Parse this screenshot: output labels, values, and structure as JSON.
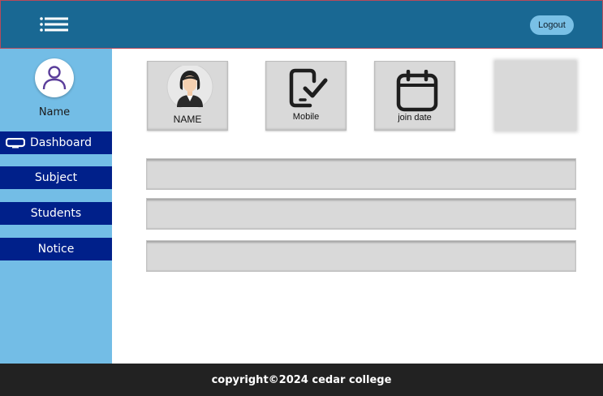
{
  "header": {
    "menu_icon": "list-menu-icon",
    "logout_label": "Logout",
    "colors": {
      "header_bg": "#196893",
      "logout_bg": "#79c0e6"
    }
  },
  "sidebar": {
    "avatar_icon": "user-avatar-icon",
    "user_name": "Name",
    "items": [
      {
        "label": "Dashboard",
        "icon": "monitor-icon"
      },
      {
        "label": "Subject"
      },
      {
        "label": "Students"
      },
      {
        "label": "Notice"
      }
    ],
    "colors": {
      "sidebar_bg": "#73bde6",
      "item_bg": "#00208a"
    }
  },
  "cards": {
    "name": {
      "label": "NAME",
      "icon": "woman-profile-icon"
    },
    "mobile": {
      "label": "Mobile",
      "icon": "mobile-check-icon"
    },
    "join_date": {
      "label": "join date",
      "icon": "calendar-icon"
    }
  },
  "footer": {
    "copyright": "copyright©2024 cedar college",
    "colors": {
      "footer_bg": "#222222"
    }
  }
}
